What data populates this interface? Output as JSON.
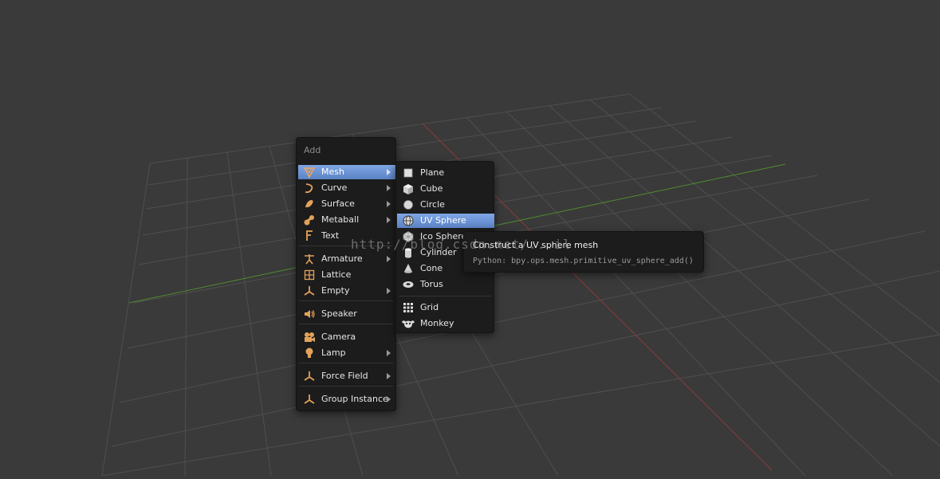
{
  "add_menu": {
    "title": "Add",
    "items": [
      {
        "label": "Mesh",
        "icon": "mesh-icon",
        "submenu": true
      },
      {
        "label": "Curve",
        "icon": "curve-icon",
        "submenu": true
      },
      {
        "label": "Surface",
        "icon": "surface-icon",
        "submenu": true
      },
      {
        "label": "Metaball",
        "icon": "metaball-icon",
        "submenu": true
      },
      {
        "label": "Text",
        "icon": "text-icon",
        "submenu": false
      },
      {
        "label": "Armature",
        "icon": "armature-icon",
        "submenu": true
      },
      {
        "label": "Lattice",
        "icon": "lattice-icon",
        "submenu": false
      },
      {
        "label": "Empty",
        "icon": "empty-icon",
        "submenu": true
      },
      {
        "label": "Speaker",
        "icon": "speaker-icon",
        "submenu": false
      },
      {
        "label": "Camera",
        "icon": "camera-icon",
        "submenu": false
      },
      {
        "label": "Lamp",
        "icon": "lamp-icon",
        "submenu": true
      },
      {
        "label": "Force Field",
        "icon": "force-field-icon",
        "submenu": true
      },
      {
        "label": "Group Instance",
        "icon": "group-instance-icon",
        "submenu": true
      }
    ]
  },
  "mesh_menu": {
    "items": [
      {
        "label": "Plane",
        "icon": "plane-icon"
      },
      {
        "label": "Cube",
        "icon": "cube-icon"
      },
      {
        "label": "Circle",
        "icon": "circle-icon"
      },
      {
        "label": "UV Sphere",
        "icon": "uv-sphere-icon"
      },
      {
        "label": "Ico Sphere",
        "icon": "ico-sphere-icon"
      },
      {
        "label": "Cylinder",
        "icon": "cylinder-icon"
      },
      {
        "label": "Cone",
        "icon": "cone-icon"
      },
      {
        "label": "Torus",
        "icon": "torus-icon"
      },
      {
        "label": "Grid",
        "icon": "grid-icon"
      },
      {
        "label": "Monkey",
        "icon": "monkey-icon"
      }
    ]
  },
  "tooltip": {
    "title": "Construct a UV sphere mesh",
    "python": "Python: bpy.ops.mesh.primitive_uv_sphere_add()"
  },
  "watermark": "http://blog.csdn.net/...il",
  "colors": {
    "viewport_bg": "#3a3a3a",
    "grid_line": "#4f4f4f",
    "x_axis": "#8e3a3a",
    "y_axis": "#4f8d2e",
    "menu_bg": "#1c1c1c",
    "highlight": "#6f97d9",
    "object_icon": "#e3a25b"
  }
}
